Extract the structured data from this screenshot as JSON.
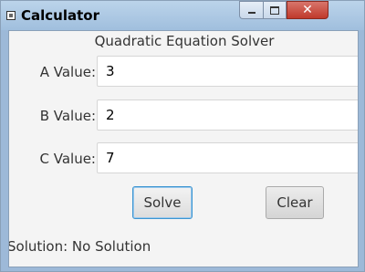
{
  "window": {
    "title": "Calculator",
    "close_glyph": "✕"
  },
  "app": {
    "heading": "Quadratic Equation Solver",
    "fields": [
      {
        "label": "A Value:",
        "value": "3"
      },
      {
        "label": "B Value:",
        "value": "2"
      },
      {
        "label": "C Value:",
        "value": "7"
      }
    ],
    "solve_label": "Solve",
    "clear_label": "Clear",
    "solution_text": "Solution: No Solution"
  },
  "icons": {
    "app": "app-window-icon",
    "minimize": "minimize-icon",
    "maximize": "maximize-icon",
    "close": "close-icon"
  },
  "colors": {
    "close_button": "#c0392b",
    "focus_border": "#3c95d1",
    "titlebar": "#a0bfde"
  }
}
